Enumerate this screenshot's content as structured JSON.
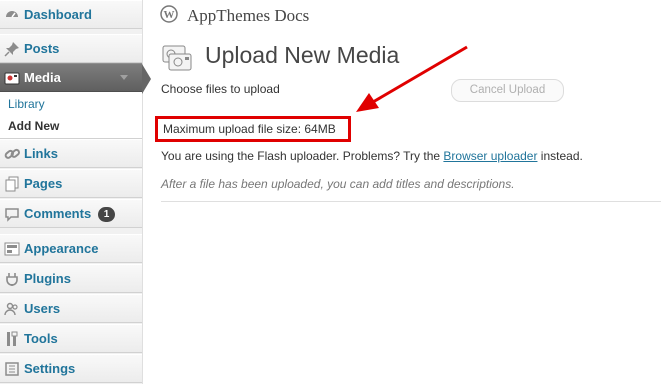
{
  "sidebar": {
    "items": [
      {
        "label": "Dashboard",
        "icon": "dashboard-icon"
      },
      {
        "label": "Posts",
        "icon": "pushpin-icon"
      },
      {
        "label": "Media",
        "icon": "media-icon",
        "current": true
      },
      {
        "label": "Links",
        "icon": "chain-link-icon"
      },
      {
        "label": "Pages",
        "icon": "pages-icon"
      },
      {
        "label": "Comments",
        "icon": "comment-bubble-icon",
        "badge": "1"
      },
      {
        "label": "Appearance",
        "icon": "appearance-icon"
      },
      {
        "label": "Plugins",
        "icon": "plug-icon"
      },
      {
        "label": "Users",
        "icon": "users-icon"
      },
      {
        "label": "Tools",
        "icon": "tools-icon"
      },
      {
        "label": "Settings",
        "icon": "settings-icon"
      }
    ],
    "media_submenu": [
      {
        "label": "Library"
      },
      {
        "label": "Add New",
        "current": true
      }
    ]
  },
  "header": {
    "site_title": "AppThemes Docs"
  },
  "main": {
    "page_title": "Upload New Media",
    "choose_label": "Choose files to upload",
    "cancel_label": "Cancel Upload",
    "max_upload": "Maximum upload file size: 64MB",
    "flash_text_before": "You are using the Flash uploader. Problems? Try the ",
    "flash_link": "Browser uploader",
    "flash_text_after": " instead.",
    "after_note": "After a file has been uploaded, you can add titles and descriptions."
  },
  "colors": {
    "link": "#21759b",
    "highlight": "#e00000",
    "current_menu": "#6d6d6d"
  }
}
